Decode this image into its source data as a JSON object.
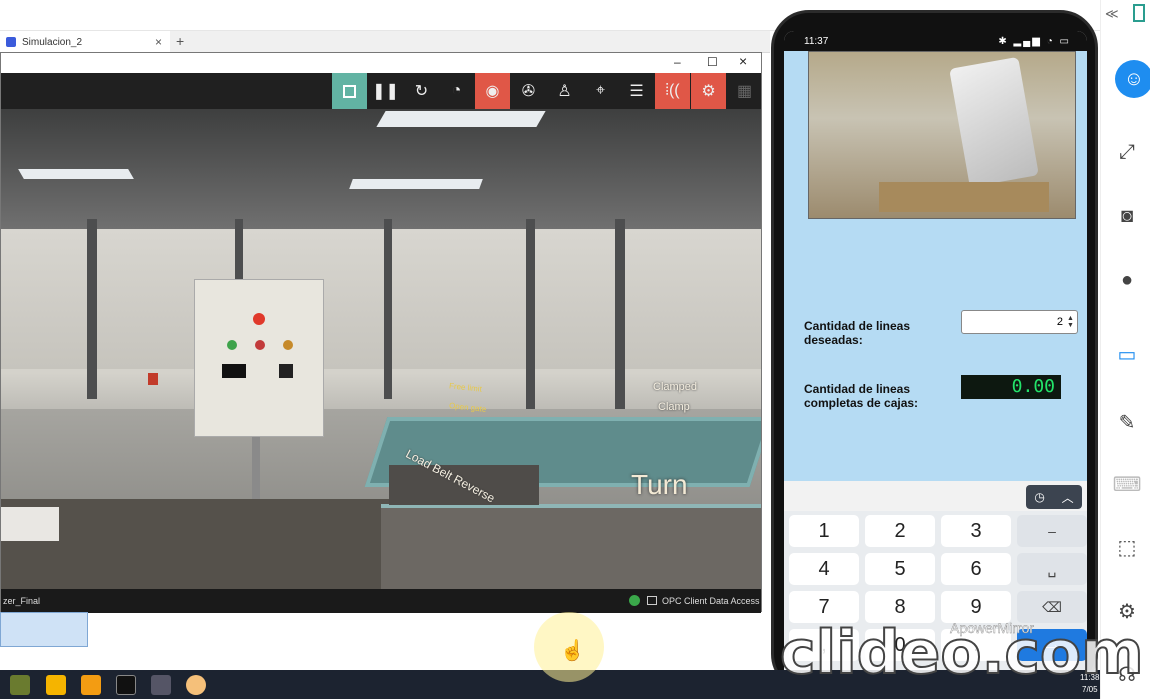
{
  "browser": {
    "tab_title": "Simulacion_2",
    "tab_close": "×",
    "new_tab": "+"
  },
  "window": {
    "minimize": "–",
    "maximize": "☐",
    "close": "×"
  },
  "toolbar": {
    "icons": [
      "stop-icon",
      "pause-icon",
      "reset-icon",
      "timer-icon",
      "camera-orbit-icon",
      "fan-icon",
      "person-icon",
      "target-icon",
      "list-icon",
      "sensor-icon",
      "drivers-icon",
      "grid-icon"
    ]
  },
  "scene": {
    "labels": {
      "clamped": "Clamped",
      "clamp": "Clamp",
      "turn": "Turn",
      "load_belt_reverse": "Load Belt Reverse",
      "free_limit": "Free limit",
      "open_gate": "Open gate"
    }
  },
  "statusbar": {
    "scene_name": "zer_Final",
    "opc_label": "OPC Client Data Access"
  },
  "phone": {
    "time": "11:37",
    "app": {
      "desired_lines_label": "Cantidad de lineas deseadas:",
      "desired_lines_value": "2",
      "completed_label": "Cantidad de lineas completas de cajas:",
      "completed_value": "0.00"
    },
    "keypad": {
      "rows": [
        [
          "1",
          "2",
          "3",
          "–"
        ],
        [
          "4",
          "5",
          "6",
          "␣"
        ],
        [
          "7",
          "8",
          "9",
          "⌫"
        ],
        [
          ",",
          "0",
          ".",
          "→"
        ]
      ]
    }
  },
  "watermarks": {
    "apowermirror": "ApowerMirror",
    "clideo": "clideo.com"
  },
  "right_rail": {
    "collapse": "≪"
  },
  "taskbar": {
    "clock": "11:38",
    "date": "7/05"
  }
}
